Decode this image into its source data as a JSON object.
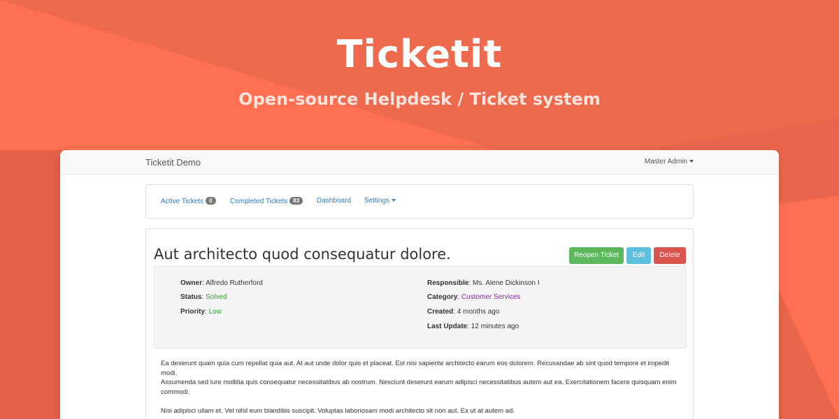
{
  "hero": {
    "title": "Ticketit",
    "subtitle": "Open-source Helpdesk / Ticket system"
  },
  "colors": {
    "background": "#e8654b",
    "background_light": "#ff7052",
    "green": "#5cb85c",
    "blue": "#5bc0de",
    "red": "#d9534f",
    "link": "#337ab7"
  },
  "navbar": {
    "brand": "Ticketit Demo",
    "user": "Master Admin"
  },
  "tabs": {
    "active": {
      "label": "Active Tickets",
      "count": "0"
    },
    "completed": {
      "label": "Completed Tickets",
      "count": "83"
    },
    "dashboard": {
      "label": "Dashboard"
    },
    "settings": {
      "label": "Settings"
    }
  },
  "ticket": {
    "title": "Aut architecto quod consequatur dolore.",
    "buttons": {
      "reopen": "Reopen Ticket",
      "edit": "Edit",
      "delete": "Delete"
    },
    "owner": {
      "label": "Owner",
      "value": "Alfredo Rutherford"
    },
    "status": {
      "label": "Status",
      "value": "Solved"
    },
    "priority": {
      "label": "Priority",
      "value": "Low"
    },
    "responsible": {
      "label": "Responsible",
      "value": "Ms. Alene Dickinson I"
    },
    "category": {
      "label": "Category",
      "value": "Customer Services"
    },
    "created": {
      "label": "Created",
      "value": "4 months ago"
    },
    "last_update": {
      "label": "Last Update",
      "value": "12 minutes ago"
    },
    "paragraphs": [
      "Ea deserunt quam quia cum repellat quia aut. At aut unde dolor quis et placeat. Est nisi sapiente architecto earum eos dolorem. Recusandae ab sint quod tempore et impedit modi.",
      "Assumenda sed iure mollitia quis consequatur necessitatibus ab nostrum. Nesciunt deserunt earum adipisci necessitatibus autem aut ea. Exercitationem facere quisquam enim commodi.",
      "Nisi adipisci ullam et. Vel nihil eum blanditiis suscipit. Voluptas laboriosam modi architecto sit non aut. Ex ut at autem ad."
    ]
  }
}
